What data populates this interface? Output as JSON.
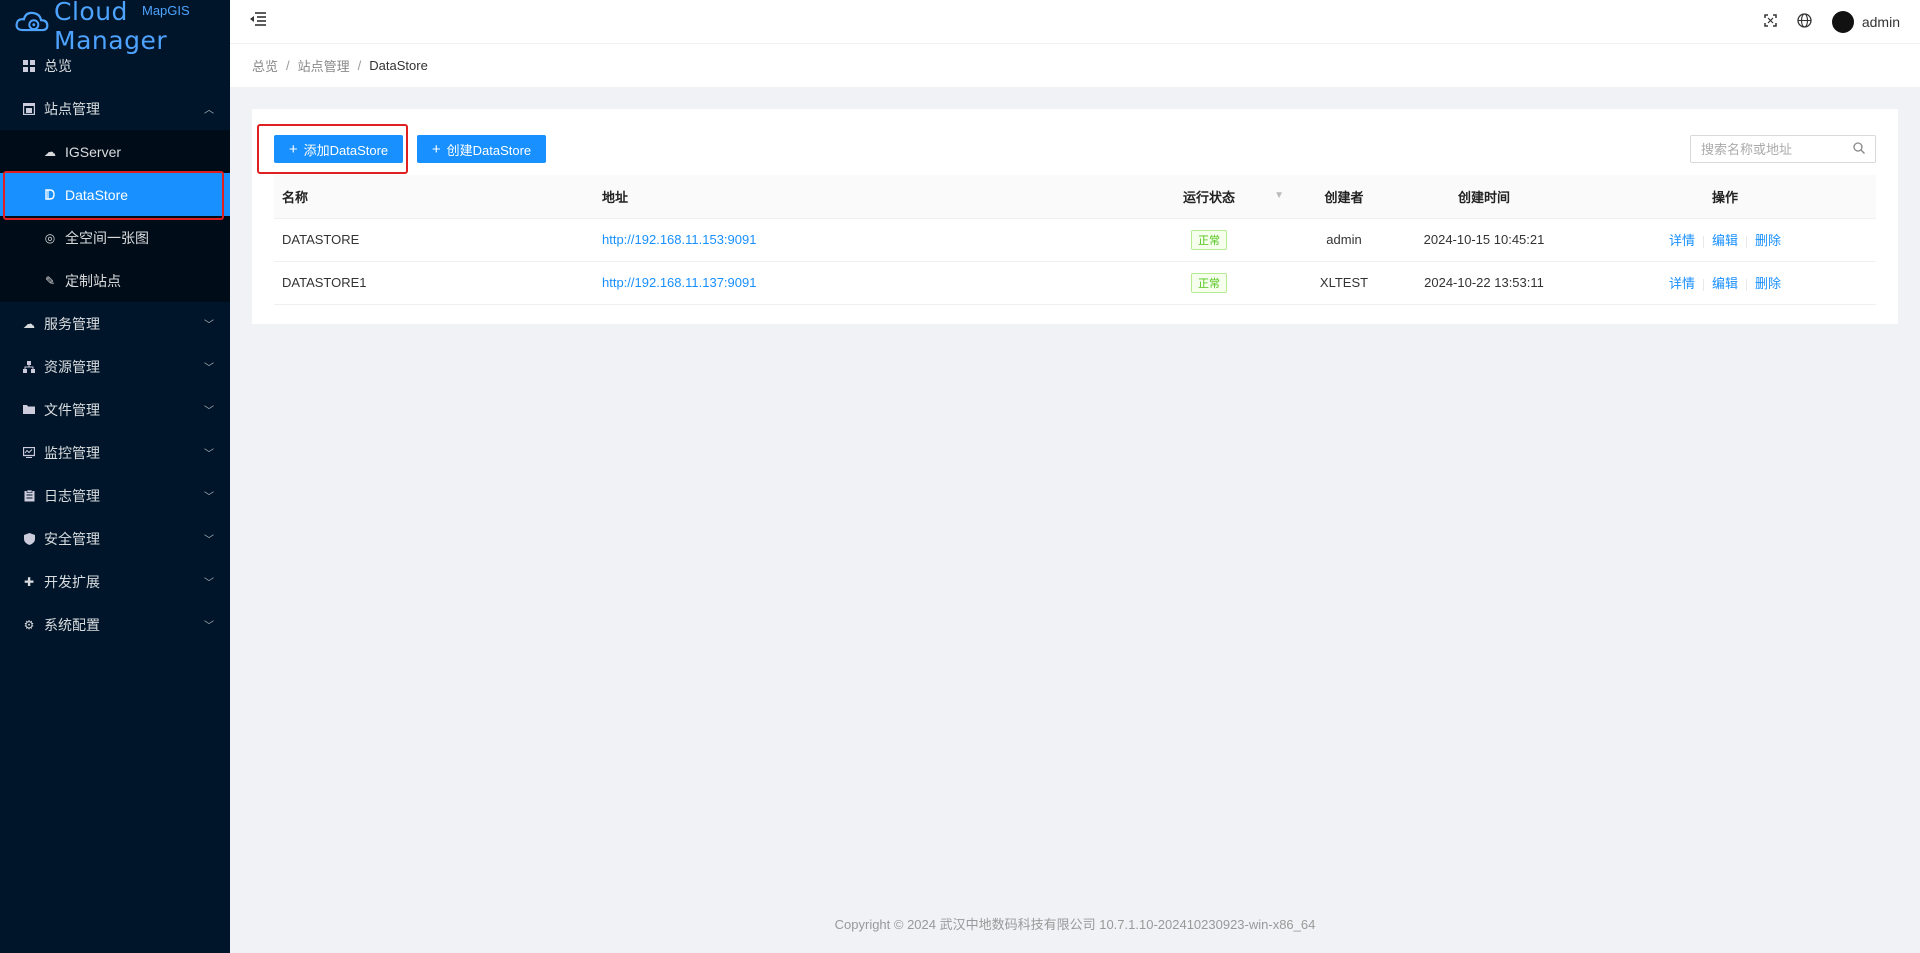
{
  "logo": {
    "text": "Cloud Manager",
    "sub": "MapGIS"
  },
  "sidebar": {
    "items": [
      {
        "label": "总览",
        "icon": "dashboard-icon"
      },
      {
        "label": "站点管理",
        "icon": "site-icon"
      },
      {
        "label": "服务管理",
        "icon": "cloud-service-icon"
      },
      {
        "label": "资源管理",
        "icon": "resource-icon"
      },
      {
        "label": "文件管理",
        "icon": "folder-icon"
      },
      {
        "label": "监控管理",
        "icon": "monitor-icon"
      },
      {
        "label": "日志管理",
        "icon": "log-icon"
      },
      {
        "label": "安全管理",
        "icon": "shield-icon"
      },
      {
        "label": "开发扩展",
        "icon": "puzzle-icon"
      },
      {
        "label": "系统配置",
        "icon": "gear-icon"
      }
    ],
    "subitems": [
      {
        "label": "IGServer",
        "icon": "igserver-icon"
      },
      {
        "label": "DataStore",
        "icon": "datastore-icon"
      },
      {
        "label": "全空间一张图",
        "icon": "globe-map-icon"
      },
      {
        "label": "定制站点",
        "icon": "custom-site-icon"
      }
    ]
  },
  "header": {
    "user": "admin"
  },
  "breadcrumb": [
    "总览",
    "站点管理",
    "DataStore"
  ],
  "toolbar": {
    "add_label": "添加DataStore",
    "create_label": "创建DataStore",
    "search_placeholder": "搜索名称或地址"
  },
  "table": {
    "headers": [
      "名称",
      "地址",
      "运行状态",
      "创建者",
      "创建时间",
      "操作"
    ],
    "rows": [
      {
        "name": "DATASTORE",
        "address": "http://192.168.11.153:9091",
        "status": "正常",
        "creator": "admin",
        "time": "2024-10-15 10:45:21"
      },
      {
        "name": "DATASTORE1",
        "address": "http://192.168.11.137:9091",
        "status": "正常",
        "creator": "XLTEST",
        "time": "2024-10-22 13:53:11"
      }
    ],
    "ops": [
      "详情",
      "编辑",
      "删除"
    ]
  },
  "footer": "Copyright © 2024 武汉中地数码科技有限公司 10.7.1.10-202410230923-win-x86_64",
  "colors": {
    "sidebar_bg": "#001529",
    "accent": "#1890ff",
    "highlight_box": "#e02020",
    "status_ok": "#52c41a"
  }
}
